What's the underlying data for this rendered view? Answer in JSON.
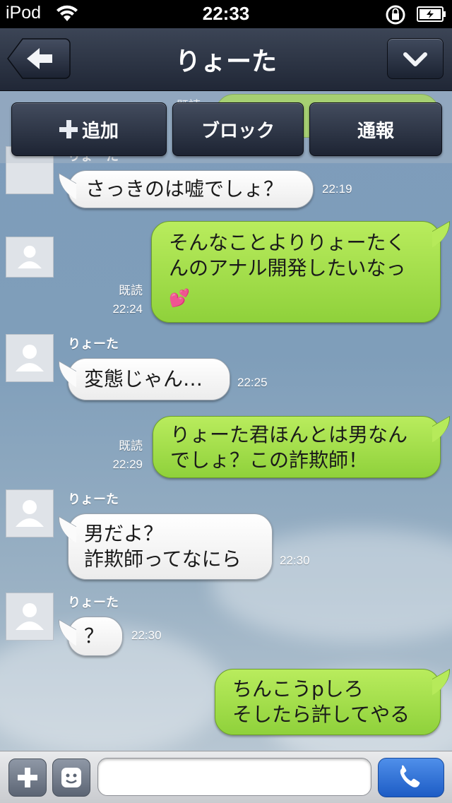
{
  "status_bar": {
    "carrier": "iPod",
    "time": "22:33"
  },
  "nav": {
    "title": "りょーた"
  },
  "actions": {
    "add": "追加",
    "block": "ブロック",
    "report": "通報"
  },
  "top_partial": {
    "read_label": "既読",
    "sender": "りょーた"
  },
  "messages": [
    {
      "side": "in",
      "sender": "",
      "lines": [
        "さっきのは嘘でしょ？"
      ],
      "time": "22:19",
      "read": ""
    },
    {
      "side": "out",
      "sender": "",
      "lines": [
        "そんなことよりりょーたく",
        "んのアナル開発したいなっ"
      ],
      "emoji": "💕",
      "time": "22:24",
      "read": "既読"
    },
    {
      "side": "in",
      "sender": "りょーた",
      "lines": [
        "変態じゃん…"
      ],
      "time": "22:25",
      "read": ""
    },
    {
      "side": "out",
      "sender": "",
      "lines": [
        "りょーた君ほんとは男なん",
        "でしょ？この詐欺師！"
      ],
      "time": "22:29",
      "read": "既読"
    },
    {
      "side": "in",
      "sender": "りょーた",
      "lines": [
        "男だよ？",
        "詐欺師ってなにら"
      ],
      "time": "22:30",
      "read": ""
    },
    {
      "side": "in",
      "sender": "りょーた",
      "lines": [
        "？"
      ],
      "time": "22:30",
      "read": ""
    },
    {
      "side": "out",
      "sender": "",
      "lines": [
        "ちんこうpしろ",
        "そしたら許してやる"
      ],
      "time": "",
      "read": ""
    }
  ],
  "input": {
    "placeholder": "",
    "value": ""
  },
  "colors": {
    "nav": "#2b3344",
    "out_bubble": "#9edb44",
    "in_bubble": "#ffffff",
    "call": "#2f6fd8"
  }
}
